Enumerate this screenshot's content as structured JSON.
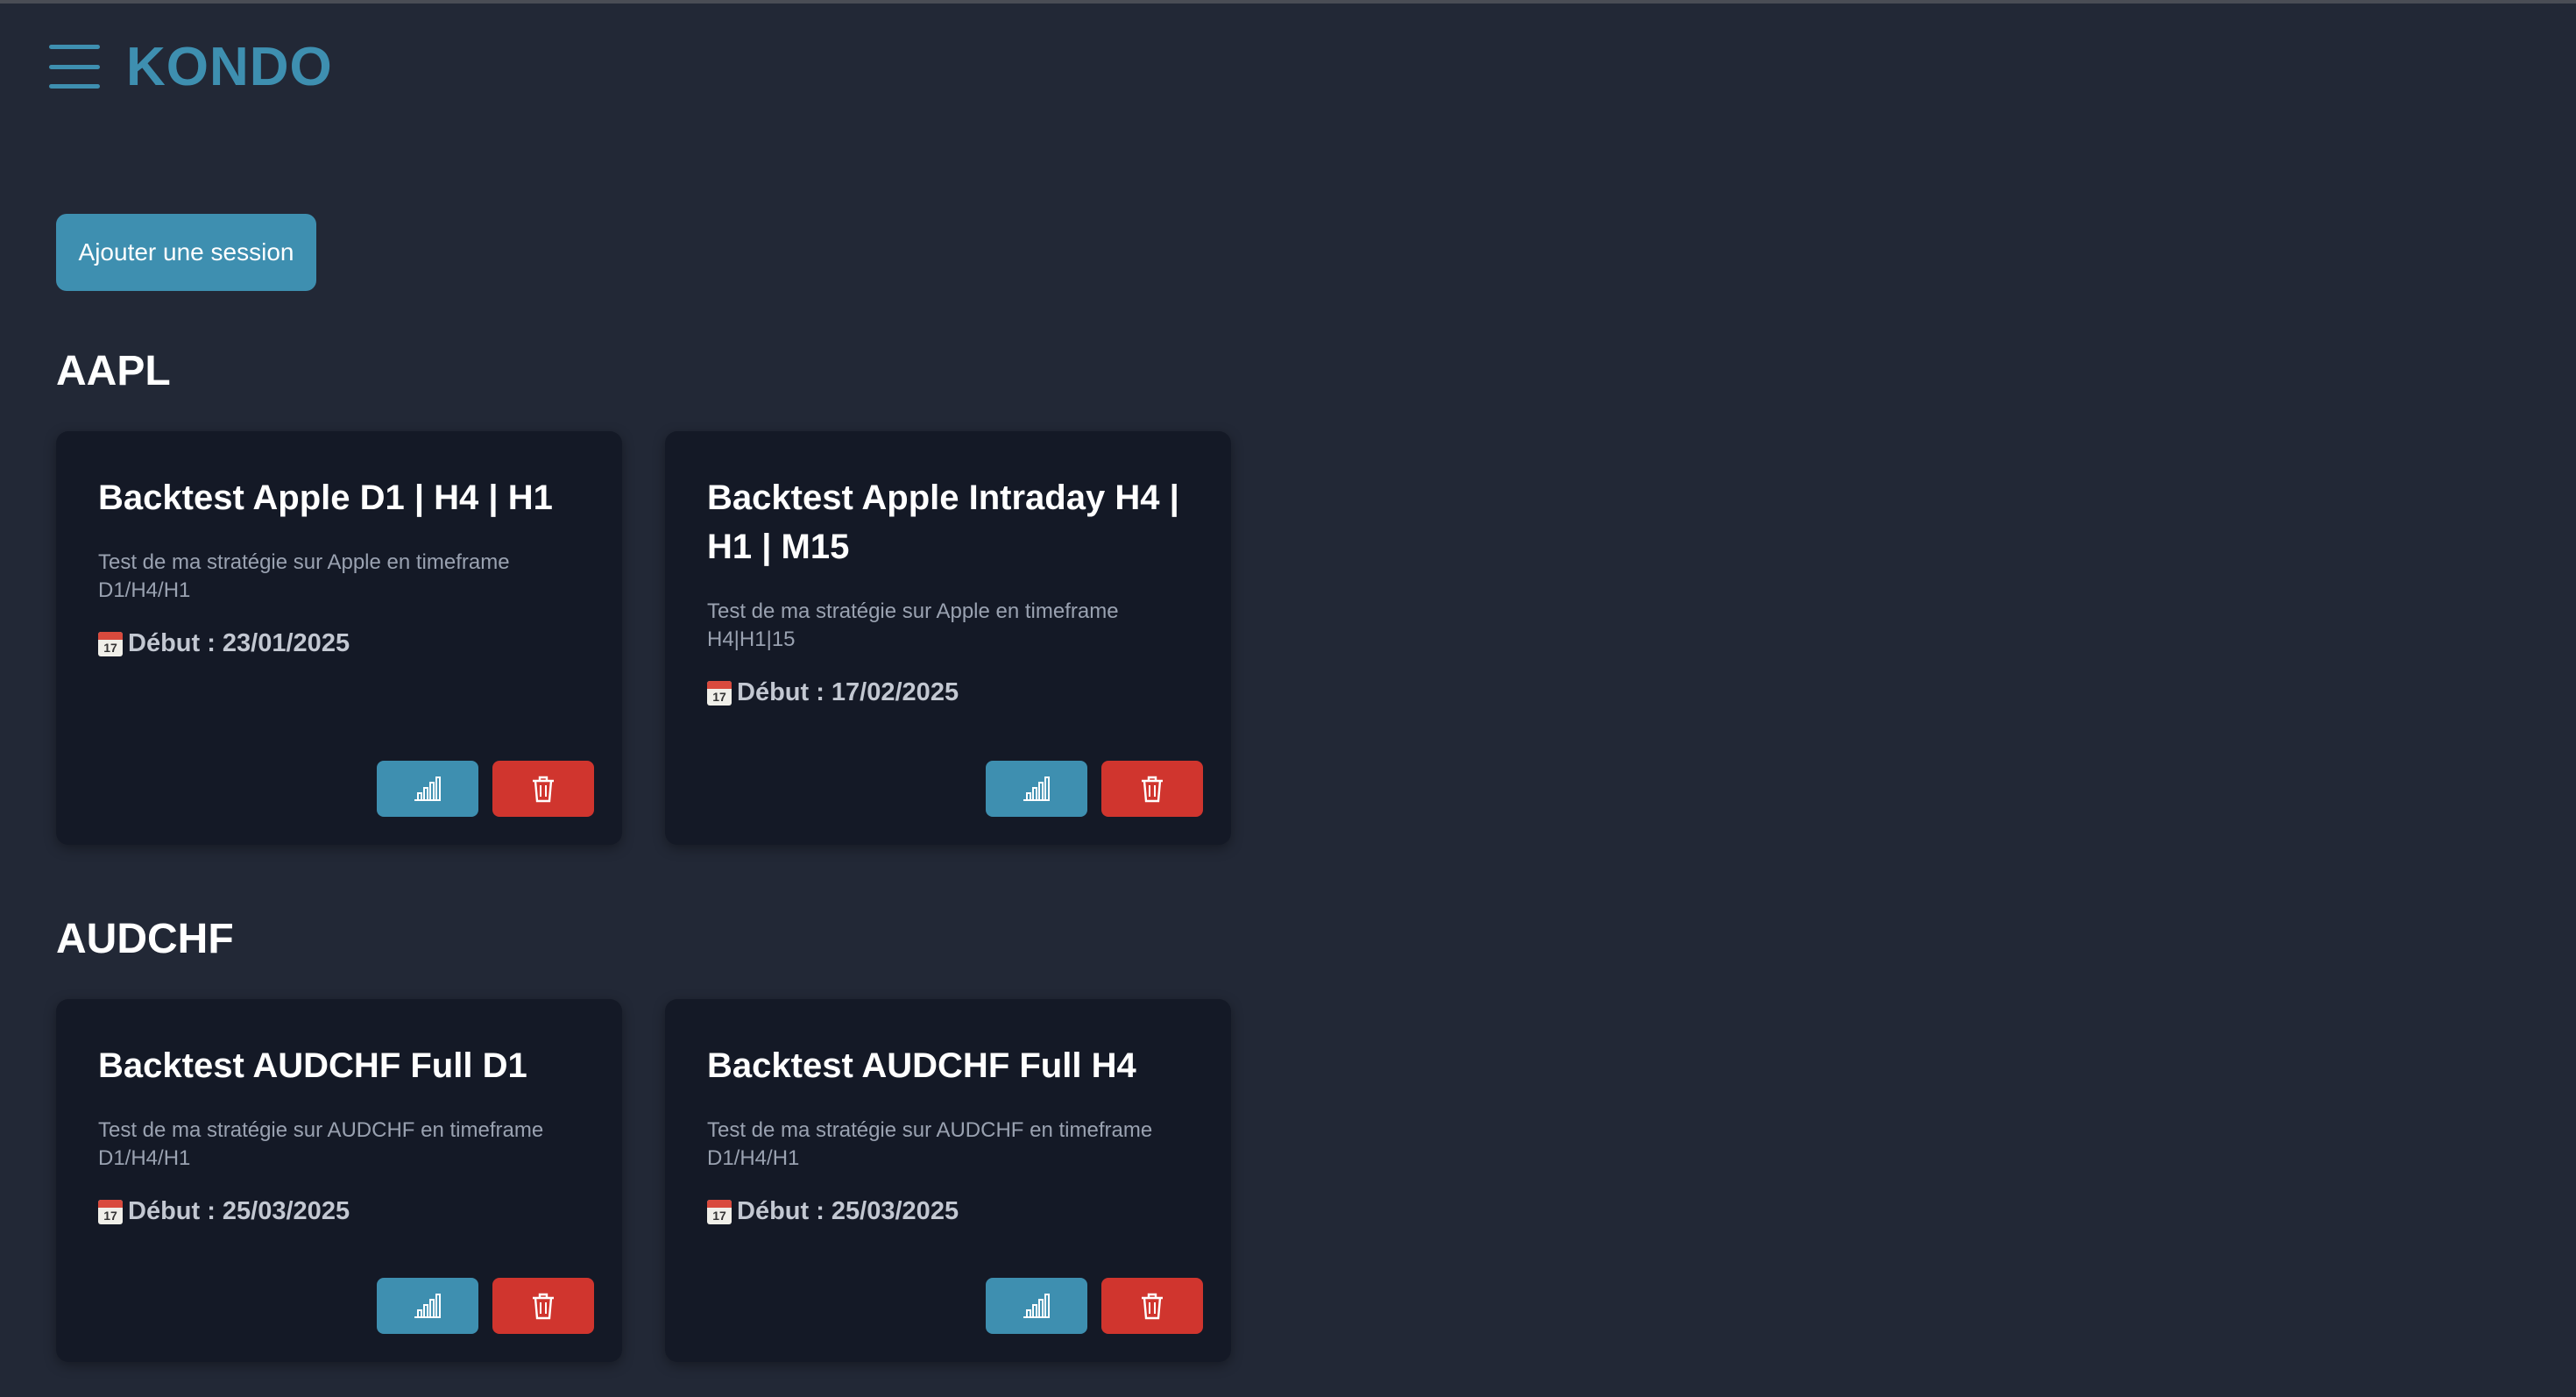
{
  "app": {
    "brand": "KONDO"
  },
  "toolbar": {
    "add_session_label": "Ajouter une session"
  },
  "groups": [
    {
      "title": "AAPL",
      "sessions": [
        {
          "title": "Backtest Apple D1 | H4 | H1",
          "description": "Test de ma stratégie sur Apple en timeframe D1/H4/H1",
          "start": "Début : 23/01/2025"
        },
        {
          "title": "Backtest Apple Intraday H4 | H1 | M15",
          "description": "Test de ma stratégie sur Apple en timeframe H4|H1|15",
          "start": "Début : 17/02/2025"
        }
      ]
    },
    {
      "title": "AUDCHF",
      "sessions": [
        {
          "title": "Backtest AUDCHF Full D1",
          "description": "Test de ma stratégie sur AUDCHF en timeframe D1/H4/H1",
          "start": "Début : 25/03/2025"
        },
        {
          "title": "Backtest AUDCHF Full H4",
          "description": "Test de ma stratégie sur AUDCHF en timeframe D1/H4/H1",
          "start": "Début : 25/03/2025"
        }
      ]
    }
  ],
  "icons": {
    "menu": "hamburger-menu-icon",
    "calendar": "calendar-icon",
    "stats": "bar-chart-icon",
    "delete": "trash-icon",
    "calendar_day": "17"
  },
  "colors": {
    "accent": "#3e8fb0",
    "danger": "#d0352e",
    "background": "#222836",
    "card": "#141926"
  }
}
